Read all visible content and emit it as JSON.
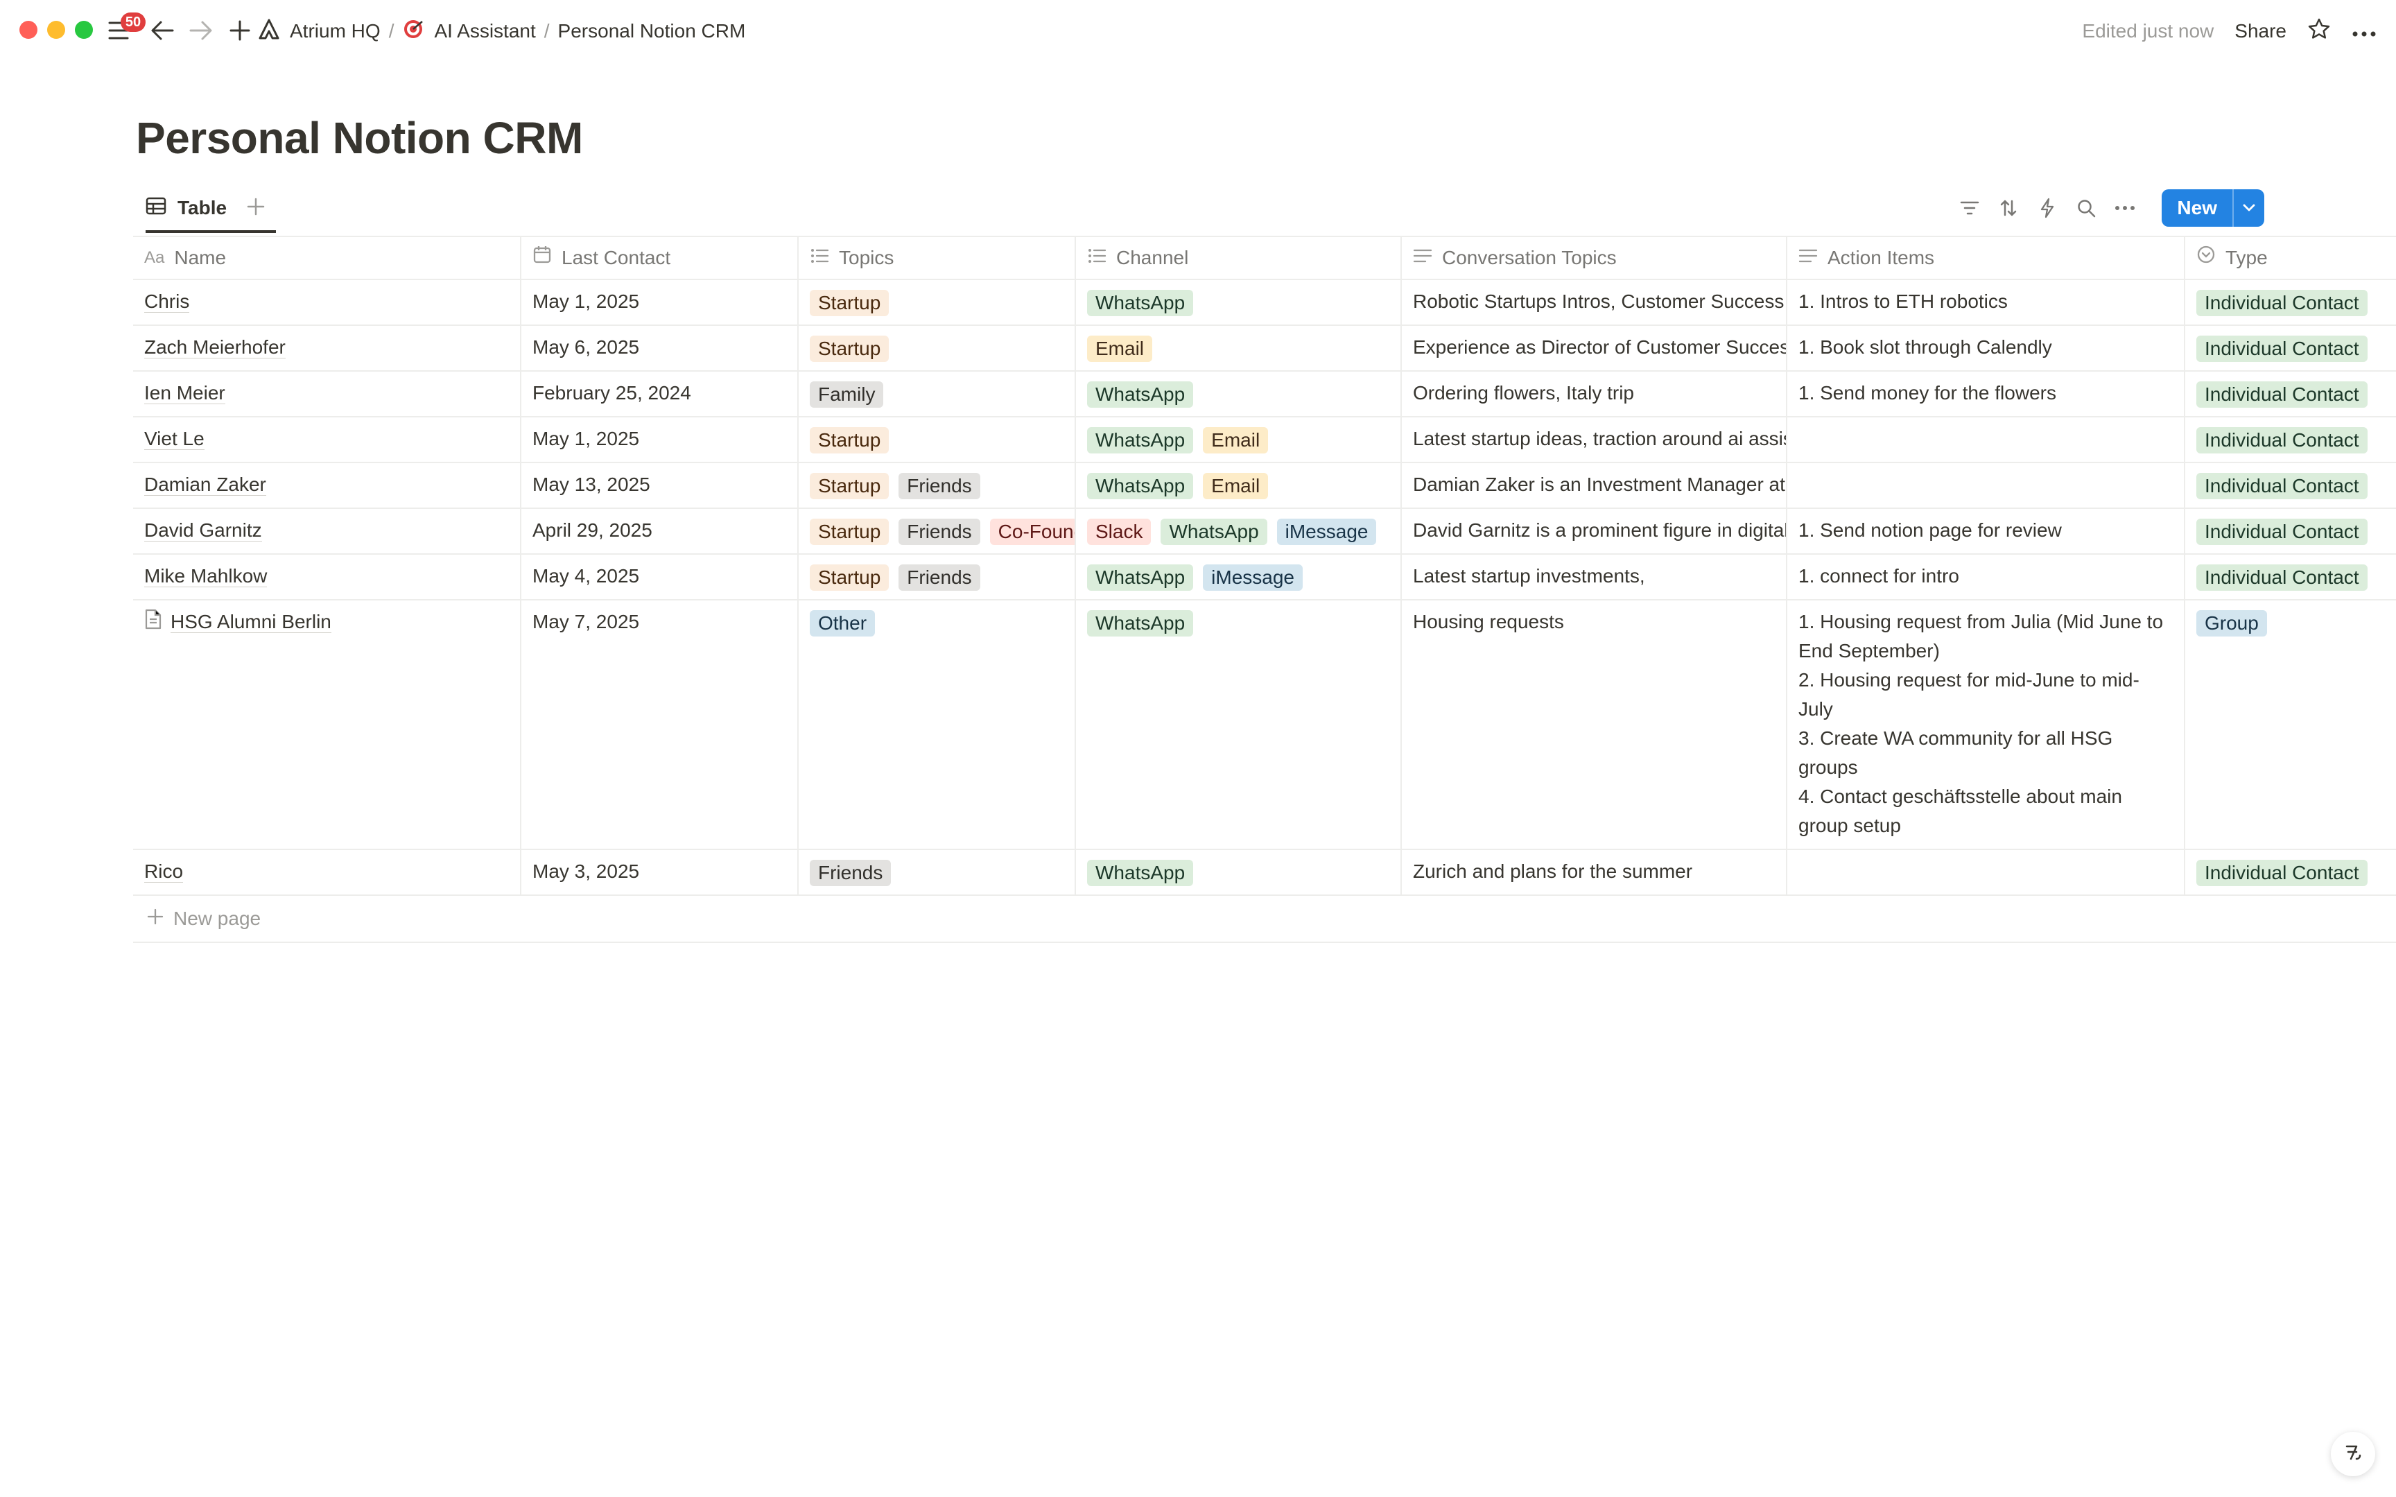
{
  "topbar": {
    "notification_count": "50",
    "breadcrumbs": [
      {
        "label": "Atrium HQ",
        "icon": "atrium-logo-icon"
      },
      {
        "label": "AI Assistant",
        "icon": "target-icon"
      },
      {
        "label": "Personal Notion CRM",
        "icon": ""
      }
    ],
    "edited": "Edited just now",
    "share_label": "Share"
  },
  "page": {
    "title": "Personal Notion CRM"
  },
  "view": {
    "tab_label": "Table",
    "new_label": "New",
    "accent": "#2383e2"
  },
  "columns": {
    "name": {
      "label": "Name",
      "icon": "Aa"
    },
    "last_contact": {
      "label": "Last Contact"
    },
    "topics": {
      "label": "Topics"
    },
    "channel": {
      "label": "Channel"
    },
    "conversation": {
      "label": "Conversation Topics"
    },
    "action_items": {
      "label": "Action Items"
    },
    "type": {
      "label": "Type"
    }
  },
  "rows": [
    {
      "name": "Chris",
      "last_contact": "May 1, 2025",
      "topics": [
        "Startup"
      ],
      "channel": [
        "WhatsApp"
      ],
      "conversation": "Robotic Startups Intros, Customer Success",
      "action_items": [
        "1. Intros to ETH robotics"
      ],
      "type": "Individual Contact"
    },
    {
      "name": "Zach Meierhofer",
      "last_contact": "May 6, 2025",
      "topics": [
        "Startup"
      ],
      "channel": [
        "Email"
      ],
      "conversation": "Experience as Director of Customer Success",
      "action_items": [
        "1. Book slot through Calendly"
      ],
      "type": "Individual Contact"
    },
    {
      "name": "Ien Meier",
      "last_contact": "February 25, 2024",
      "topics": [
        "Family"
      ],
      "channel": [
        "WhatsApp"
      ],
      "conversation": "Ordering flowers, Italy trip",
      "action_items": [
        "1. Send money for the flowers"
      ],
      "type": "Individual Contact"
    },
    {
      "name": "Viet Le",
      "last_contact": "May 1, 2025",
      "topics": [
        "Startup"
      ],
      "channel": [
        "WhatsApp",
        "Email"
      ],
      "conversation": "Latest startup ideas, traction around ai assistants",
      "action_items": [],
      "type": "Individual Contact"
    },
    {
      "name": "Damian Zaker",
      "last_contact": "May 13, 2025",
      "topics": [
        "Startup",
        "Friends"
      ],
      "channel": [
        "WhatsApp",
        "Email"
      ],
      "conversation": "Damian Zaker is an Investment Manager at",
      "action_items": [],
      "type": "Individual Contact"
    },
    {
      "name": "David Garnitz",
      "last_contact": "April 29, 2025",
      "topics": [
        "Startup",
        "Friends",
        "Co-Founder"
      ],
      "channel": [
        "Slack",
        "WhatsApp",
        "iMessage"
      ],
      "conversation": "David Garnitz is a prominent figure in digital",
      "action_items": [
        "1. Send notion page for review"
      ],
      "type": "Individual Contact"
    },
    {
      "name": "Mike Mahlkow",
      "last_contact": "May 4, 2025",
      "topics": [
        "Startup",
        "Friends"
      ],
      "channel": [
        "WhatsApp",
        "iMessage"
      ],
      "conversation": "Latest startup investments,",
      "action_items": [
        "1. connect for intro"
      ],
      "type": "Individual Contact"
    },
    {
      "name": "HSG Alumni Berlin",
      "last_contact": "May 7, 2025",
      "topics": [
        "Other"
      ],
      "channel": [
        "WhatsApp"
      ],
      "conversation": "Housing requests",
      "action_items": [
        "1. Housing request from Julia (Mid June to End September)",
        "2. Housing request for mid-June to mid-July",
        "3. Create WA community for all HSG groups",
        "4. Contact geschäftsstelle about main group setup"
      ],
      "type": "Group"
    },
    {
      "name": "Rico",
      "last_contact": "May 3, 2025",
      "topics": [
        "Friends"
      ],
      "channel": [
        "WhatsApp"
      ],
      "conversation": "Zurich and plans for the summer",
      "action_items": [],
      "type": "Individual Contact"
    }
  ],
  "table": {
    "new_page_label": "New page"
  }
}
